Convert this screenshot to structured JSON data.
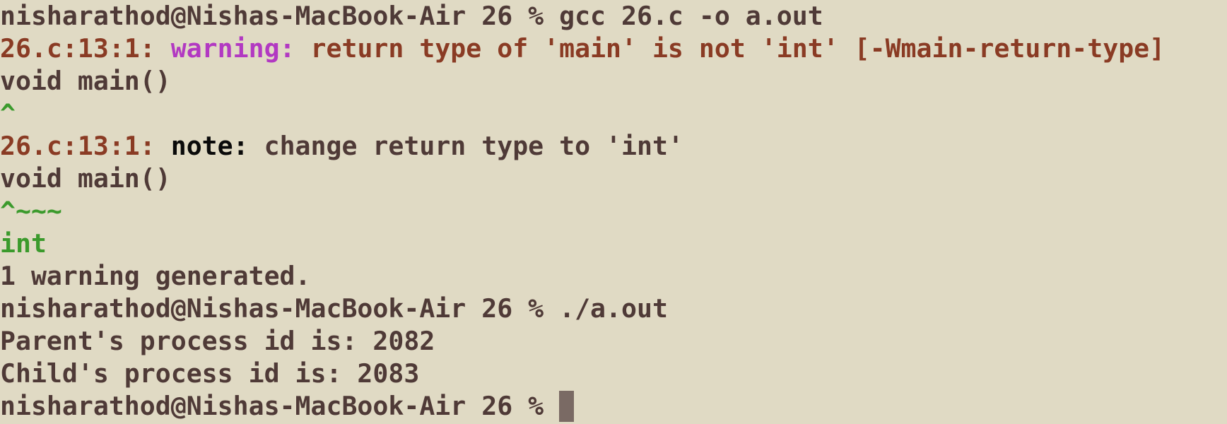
{
  "terminal": {
    "prompt": "nisharathod@Nishas-MacBook-Air 26 % ",
    "command1": "gcc 26.c -o a.out",
    "diag1": {
      "location": "26.c:13:1: ",
      "severity": "warning: ",
      "message": "return type of 'main' is not 'int' [-Wmain-return-type]"
    },
    "source1": "void main()",
    "caret1": "^",
    "diag2": {
      "location": "26.c:13:1: ",
      "severity": "note: ",
      "message": "change return type to 'int'"
    },
    "source2": "void main()",
    "caret2": "^~~~",
    "fixit": "int",
    "summary": "1 warning generated.",
    "command2": "./a.out",
    "output1": "Parent's process id is: 2082",
    "output2": "Child's process id is: 2083"
  },
  "colors": {
    "background": "#e0dac4",
    "text": "#4f3a37",
    "location": "#8a3b24",
    "warning": "#b239c2",
    "caret": "#3b9a2c",
    "cursor": "#7a6a64"
  }
}
